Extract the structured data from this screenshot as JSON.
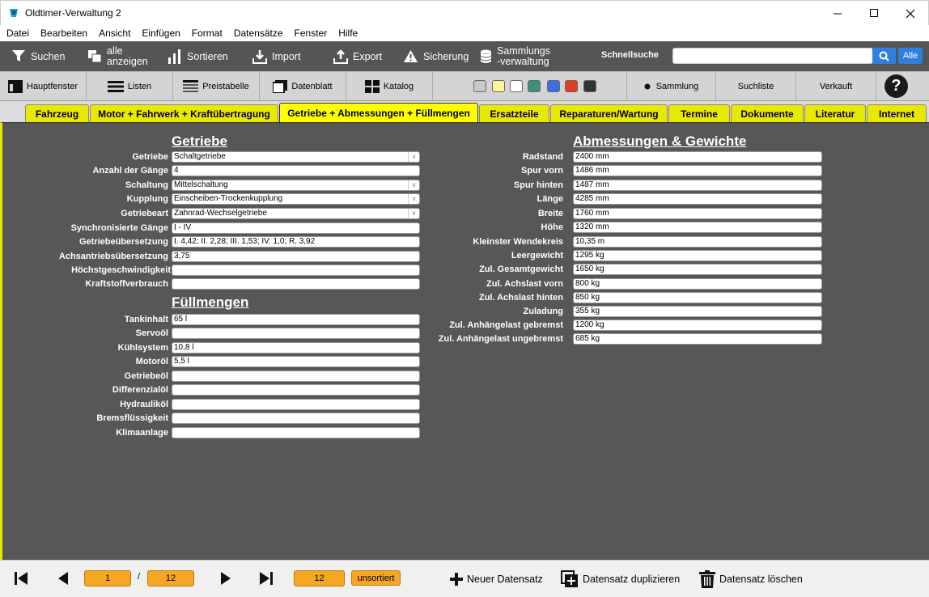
{
  "window": {
    "title": "Oldtimer-Verwaltung 2"
  },
  "menu": [
    "Datei",
    "Bearbeiten",
    "Ansicht",
    "Einfügen",
    "Format",
    "Datensätze",
    "Fenster",
    "Hilfe"
  ],
  "toolbar1": {
    "search": "Suchen",
    "show_all_1": "alle",
    "show_all_2": "anzeigen",
    "sort": "Sortieren",
    "import": "Import",
    "export": "Export",
    "backup": "Sicherung",
    "collection_1": "Sammlungs",
    "collection_2": "-verwaltung",
    "quicksearch_label": "Schnellsuche",
    "quicksearch_value": "",
    "all_label": "Alle"
  },
  "toolbar2": {
    "main_window": "Hauptfenster",
    "lists": "Listen",
    "price_table": "Preistabelle",
    "data_sheet": "Datenblatt",
    "catalog": "Katalog",
    "swatches": [
      "#c8c8c8",
      "#fff59a",
      "#ffffff",
      "#3f8f80",
      "#3c6fe0",
      "#e04020",
      "#333333"
    ],
    "collection": "Sammlung",
    "search_list": "Suchliste",
    "sold": "Verkauft",
    "help": "?"
  },
  "tabs": [
    "Fahrzeug",
    "Motor + Fahrwerk + Kraftübertragung",
    "Getriebe + Abmessungen + Füllmengen",
    "Ersatzteile",
    "Reparaturen/Wartung",
    "Termine",
    "Dokumente",
    "Literatur",
    "Internet"
  ],
  "getriebe": {
    "title": "Getriebe",
    "fields": [
      {
        "label": "Getriebe",
        "value": "Schaltgetriebe",
        "dropdown": true
      },
      {
        "label": "Anzahl der Gänge",
        "value": "4",
        "dropdown": false
      },
      {
        "label": "Schaltung",
        "value": "Mittelschaltung",
        "dropdown": true
      },
      {
        "label": "Kupplung",
        "value": "Einscheiben-Trockenkupplung",
        "dropdown": true
      },
      {
        "label": "Getriebeart",
        "value": "Zahnrad-Wechselgetriebe",
        "dropdown": true
      },
      {
        "label": "Synchronisierte Gänge",
        "value": "I - IV",
        "dropdown": false
      },
      {
        "label": "Getriebeübersetzung",
        "value": "I. 4,42; II. 2,28; III. 1,53; IV. 1,0; R. 3,92",
        "dropdown": false
      },
      {
        "label": "Achsantriebsübersetzung",
        "value": "3,75",
        "dropdown": false
      },
      {
        "label": "Höchstgeschwindigkeit",
        "value": "",
        "dropdown": false
      },
      {
        "label": "Kraftstoffverbrauch",
        "value": "",
        "dropdown": false
      }
    ]
  },
  "fuellmengen": {
    "title": "Füllmengen",
    "fields": [
      {
        "label": "Tankinhalt",
        "value": "65 l"
      },
      {
        "label": "Servoöl",
        "value": ""
      },
      {
        "label": "Kühlsystem",
        "value": "10,8 l"
      },
      {
        "label": "Motoröl",
        "value": "5,5 l"
      },
      {
        "label": "Getriebeöl",
        "value": ""
      },
      {
        "label": "Differenzialöl",
        "value": ""
      },
      {
        "label": "Hydrauliköl",
        "value": ""
      },
      {
        "label": "Bremsflüssigkeit",
        "value": ""
      },
      {
        "label": "Klimaanlage",
        "value": ""
      }
    ]
  },
  "abmessungen": {
    "title": "Abmessungen & Gewichte",
    "fields": [
      {
        "label": "Radstand",
        "value": "2400 mm"
      },
      {
        "label": "Spur vorn",
        "value": "1486 mm"
      },
      {
        "label": "Spur hinten",
        "value": "1487 mm"
      },
      {
        "label": "Länge",
        "value": "4285 mm"
      },
      {
        "label": "Breite",
        "value": "1760 mm"
      },
      {
        "label": "Höhe",
        "value": "1320 mm"
      },
      {
        "label": "Kleinster Wendekreis",
        "value": "10,35 m"
      },
      {
        "label": "Leergewicht",
        "value": "1295 kg"
      },
      {
        "label": "Zul. Gesamtgewicht",
        "value": "1650 kg"
      },
      {
        "label": "Zul. Achslast vorn",
        "value": "800 kg"
      },
      {
        "label": "Zul. Achslast hinten",
        "value": "850 kg"
      },
      {
        "label": "Zuladung",
        "value": "355 kg"
      },
      {
        "label": "Zul. Anhängelast gebremst",
        "value": "1200 kg"
      },
      {
        "label": "Zul. Anhängelast ungebremst",
        "value": "685 kg"
      }
    ]
  },
  "bottom": {
    "current": "1",
    "separator": "/",
    "total": "12",
    "count": "12",
    "sort_state": "unsortiert",
    "new_record": "Neuer Datensatz",
    "duplicate_record": "Datensatz duplizieren",
    "delete_record": "Datensatz löschen"
  }
}
